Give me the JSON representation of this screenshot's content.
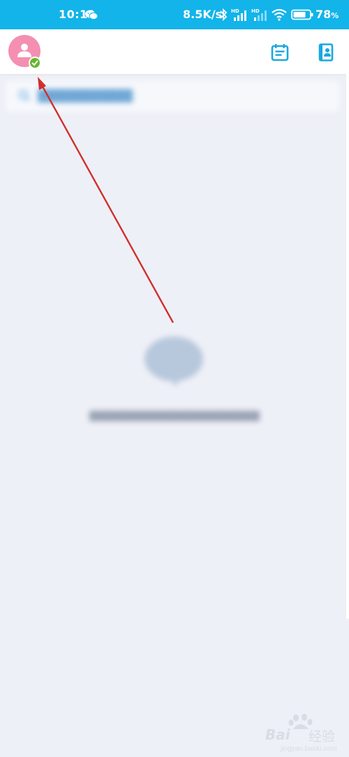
{
  "status_bar": {
    "time": "10:11",
    "network_speed": "8.5K/s",
    "signal_label": "HD",
    "battery_level": "78",
    "battery_unit": "%",
    "icons": [
      "wechat-icon",
      "bluetooth-icon",
      "signal-icon",
      "signal-icon",
      "wifi-icon",
      "battery-icon"
    ]
  },
  "header": {
    "avatar_icon": "person-icon",
    "status_icon": "check-icon",
    "right_icons": [
      "calendar-icon",
      "contacts-icon"
    ]
  },
  "watermark": {
    "brand": "Bai",
    "brand_suffix": "经验",
    "url": "jingyan.baidu.com"
  },
  "colors": {
    "status_bar": "#12b4ea",
    "accent": "#1aa7e0",
    "avatar": "#f48fb1",
    "online": "#64b82b",
    "background": "#eef0f7",
    "annotation": "#d0302b"
  }
}
